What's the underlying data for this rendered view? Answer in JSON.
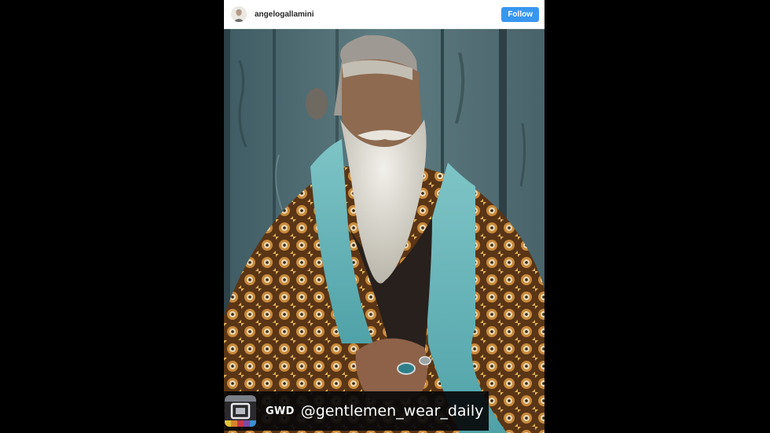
{
  "post": {
    "username": "angelogallamini",
    "follow_label": "Follow"
  },
  "watermark": {
    "brand": "GWD",
    "handle": "@gentlemen_wear_daily"
  },
  "colors": {
    "follow_button": "#3897f0",
    "header_background": "#ffffff",
    "page_background": "#000000"
  }
}
